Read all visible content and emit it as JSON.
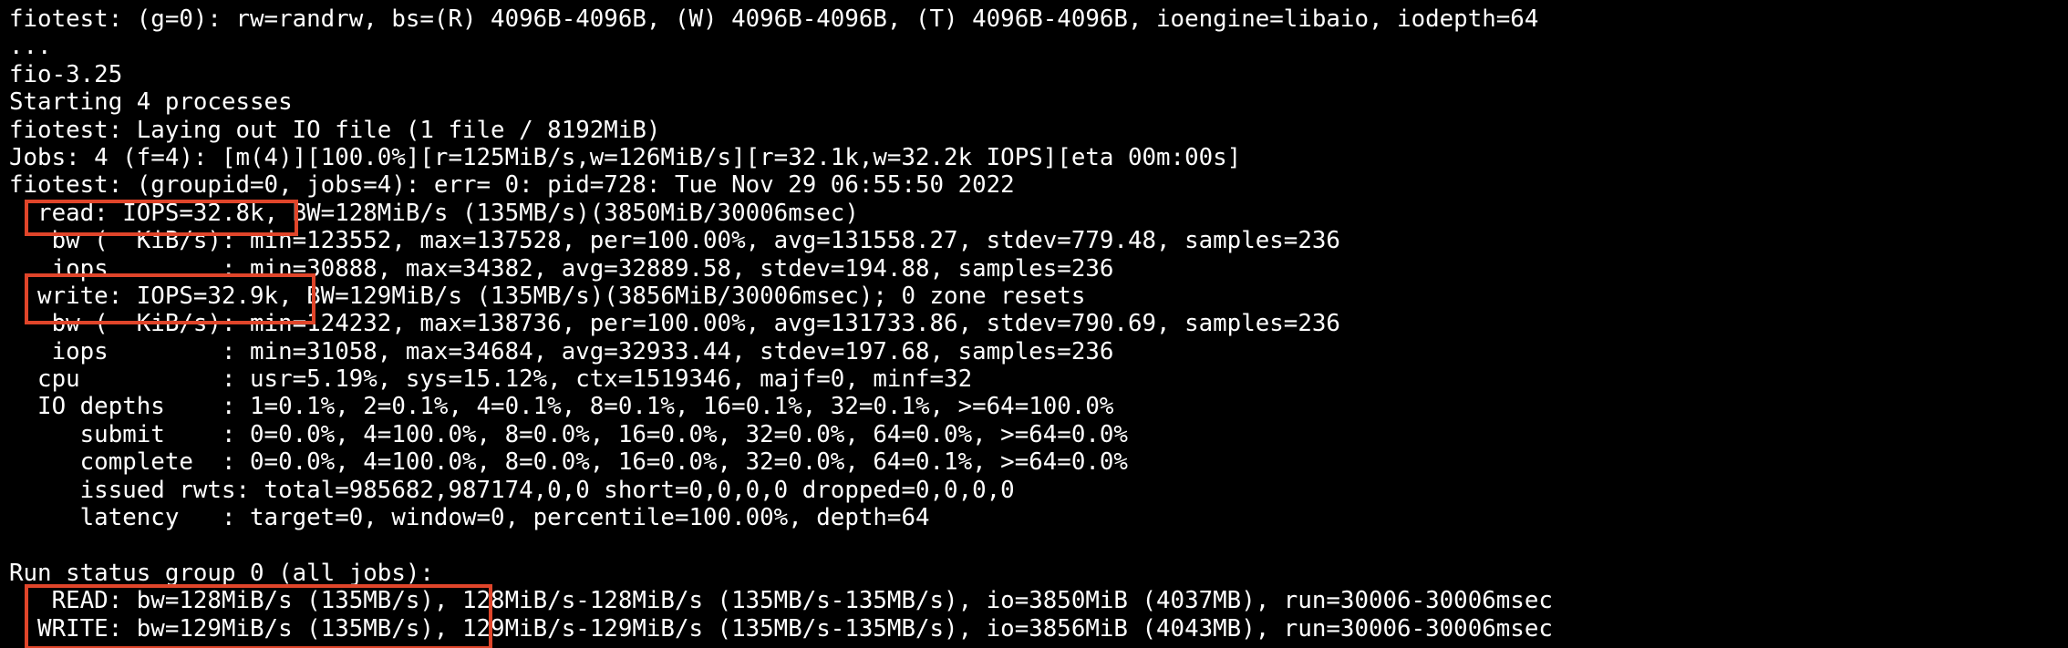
{
  "terminal": {
    "background": "#000000",
    "text_color": "#ffffff",
    "highlight_color": "#e0452a",
    "lines": [
      "fiotest: (g=0): rw=randrw, bs=(R) 4096B-4096B, (W) 4096B-4096B, (T) 4096B-4096B, ioengine=libaio, iodepth=64",
      "...",
      "fio-3.25",
      "Starting 4 processes",
      "fiotest: Laying out IO file (1 file / 8192MiB)",
      "Jobs: 4 (f=4): [m(4)][100.0%][r=125MiB/s,w=126MiB/s][r=32.1k,w=32.2k IOPS][eta 00m:00s]",
      "fiotest: (groupid=0, jobs=4): err= 0: pid=728: Tue Nov 29 06:55:50 2022",
      "  read: IOPS=32.8k, BW=128MiB/s (135MB/s)(3850MiB/30006msec)",
      "   bw (  KiB/s): min=123552, max=137528, per=100.00%, avg=131558.27, stdev=779.48, samples=236",
      "   iops        : min=30888, max=34382, avg=32889.58, stdev=194.88, samples=236",
      "  write: IOPS=32.9k, BW=129MiB/s (135MB/s)(3856MiB/30006msec); 0 zone resets",
      "   bw (  KiB/s): min=124232, max=138736, per=100.00%, avg=131733.86, stdev=790.69, samples=236",
      "   iops        : min=31058, max=34684, avg=32933.44, stdev=197.68, samples=236",
      "  cpu          : usr=5.19%, sys=15.12%, ctx=1519346, majf=0, minf=32",
      "  IO depths    : 1=0.1%, 2=0.1%, 4=0.1%, 8=0.1%, 16=0.1%, 32=0.1%, >=64=100.0%",
      "     submit    : 0=0.0%, 4=100.0%, 8=0.0%, 16=0.0%, 32=0.0%, 64=0.0%, >=64=0.0%",
      "     complete  : 0=0.0%, 4=100.0%, 8=0.0%, 16=0.0%, 32=0.0%, 64=0.1%, >=64=0.0%",
      "     issued rwts: total=985682,987174,0,0 short=0,0,0,0 dropped=0,0,0,0",
      "     latency   : target=0, window=0, percentile=100.00%, depth=64",
      "",
      "Run status group 0 (all jobs):",
      "   READ: bw=128MiB/s (135MB/s), 128MiB/s-128MiB/s (135MB/s-135MB/s), io=3850MiB (4037MB), run=30006-30006msec",
      "  WRITE: bw=129MiB/s (135MB/s), 129MiB/s-129MiB/s (135MB/s-135MB/s), io=3856MiB (4043MB), run=30006-30006msec"
    ]
  }
}
